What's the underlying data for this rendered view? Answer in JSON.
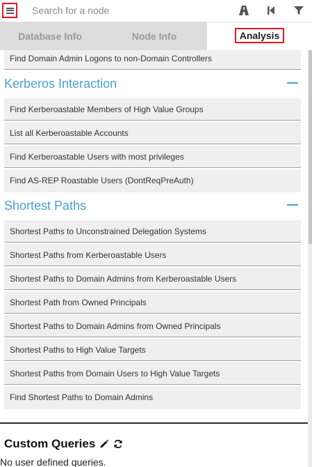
{
  "search": {
    "placeholder": "Search for a node"
  },
  "tabs": [
    {
      "label": "Database Info"
    },
    {
      "label": "Node Info"
    },
    {
      "label": "Analysis"
    }
  ],
  "analysis": {
    "top_items": [
      "Find Domain Admin Logons to non-Domain Controllers"
    ],
    "kerberos": {
      "title": "Kerberos Interaction",
      "items": [
        "Find Kerberoastable Members of High Value Groups",
        "List all Kerberoastable Accounts",
        "Find Kerberoastable Users with most privileges",
        "Find AS-REP Roastable Users (DontReqPreAuth)"
      ]
    },
    "shortest": {
      "title": "Shortest Paths",
      "items": [
        "Shortest Paths to Unconstrained Delegation Systems",
        "Shortest Paths from Kerberoastable Users",
        "Shortest Paths to Domain Admins from Kerberoastable Users",
        "Shortest Path from Owned Principals",
        "Shortest Paths to Domain Admins from Owned Principals",
        "Shortest Paths to High Value Targets",
        "Shortest Paths from Domain Users to High Value Targets",
        "Find Shortest Paths to Domain Admins"
      ]
    },
    "custom": {
      "title": "Custom Queries",
      "empty_text": "No user defined queries."
    }
  },
  "colors": {
    "accent": "#4a9fd8",
    "highlight": "#e8141f",
    "tab_inactive": "#dcdcdc",
    "item_bg": "#efefef"
  },
  "icons": {
    "menu": "hamburger-menu-icon",
    "pathfinding": "road-icon",
    "back": "step-backward-icon",
    "filter": "filter-icon",
    "edit": "pencil-icon",
    "refresh": "refresh-icon",
    "collapse": "minus-icon"
  }
}
